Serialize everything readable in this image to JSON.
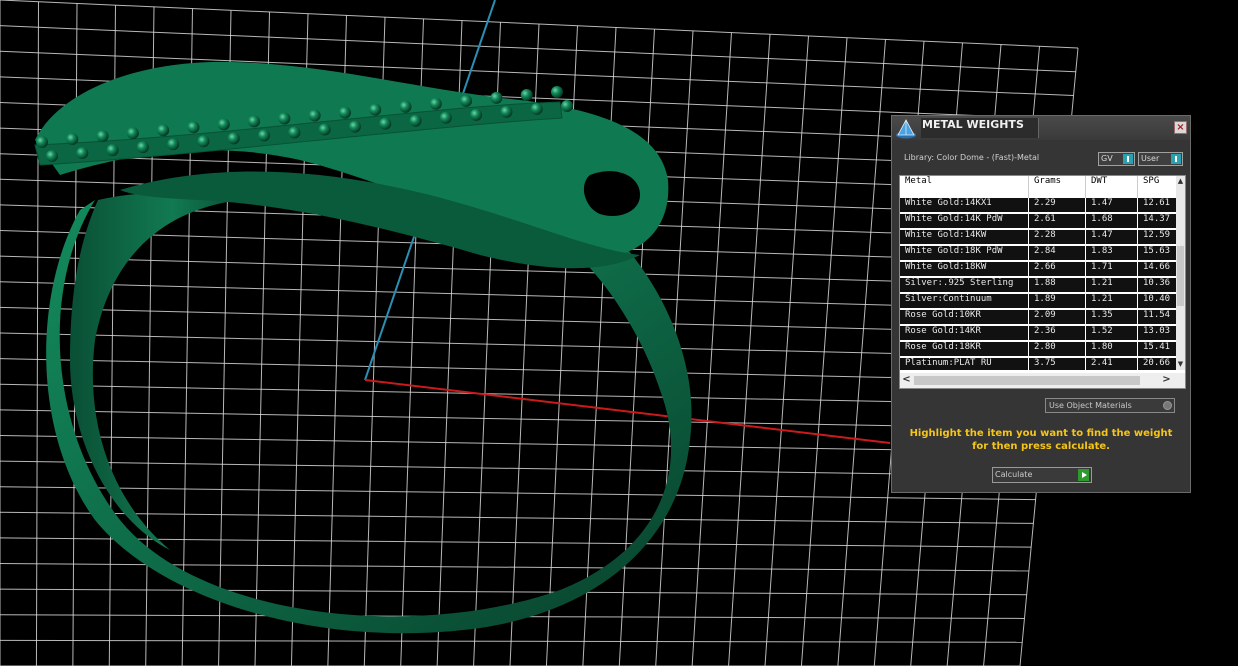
{
  "panel": {
    "title": "METAL WEIGHTS",
    "close_glyph": "×",
    "library_label": "Library: Color Dome - (Fast)-Metal",
    "toggles": {
      "gv": "GV",
      "user": "User"
    },
    "columns": [
      "Metal",
      "Grams",
      "DWT",
      "SPG"
    ],
    "rows": [
      {
        "metal": "White Gold:14KX1",
        "grams": "2.29",
        "dwt": "1.47",
        "spg": "12.61"
      },
      {
        "metal": "White Gold:14K PdW",
        "grams": "2.61",
        "dwt": "1.68",
        "spg": "14.37"
      },
      {
        "metal": "White Gold:14KW",
        "grams": "2.28",
        "dwt": "1.47",
        "spg": "12.59"
      },
      {
        "metal": "White Gold:18K PdW",
        "grams": "2.84",
        "dwt": "1.83",
        "spg": "15.63"
      },
      {
        "metal": "White Gold:18KW",
        "grams": "2.66",
        "dwt": "1.71",
        "spg": "14.66"
      },
      {
        "metal": "Silver:.925 Sterling",
        "grams": "1.88",
        "dwt": "1.21",
        "spg": "10.36"
      },
      {
        "metal": "Silver:Continuum",
        "grams": "1.89",
        "dwt": "1.21",
        "spg": "10.40"
      },
      {
        "metal": "Rose Gold:10KR",
        "grams": "2.09",
        "dwt": "1.35",
        "spg": "11.54"
      },
      {
        "metal": "Rose Gold:14KR",
        "grams": "2.36",
        "dwt": "1.52",
        "spg": "13.03"
      },
      {
        "metal": "Rose Gold:18KR",
        "grams": "2.80",
        "dwt": "1.80",
        "spg": "15.41"
      },
      {
        "metal": "Platinum:PLAT RU",
        "grams": "3.75",
        "dwt": "2.41",
        "spg": "20.66"
      }
    ],
    "use_object_materials": "Use Object Materials",
    "instruction_line1": "Highlight the item you want to find the weight",
    "instruction_line2": "for then press calculate.",
    "calculate_label": "Calculate",
    "scroll": {
      "up": "▲",
      "down": "▼",
      "left": "<",
      "right": ">"
    }
  },
  "colors": {
    "ring": "#0e6b48",
    "bead": "#0a5e3f",
    "grid": "#d8d8d8",
    "background": "#000000",
    "x_axis": "#cc1a1a",
    "y_axis": "#2b8fb5",
    "instruction_text": "#f5c518",
    "toggle_knob": "#2ba0b0"
  },
  "icons": {
    "logo": "cone-dome-logo-icon",
    "close": "close-icon",
    "calculate": "play-arrow-icon"
  }
}
